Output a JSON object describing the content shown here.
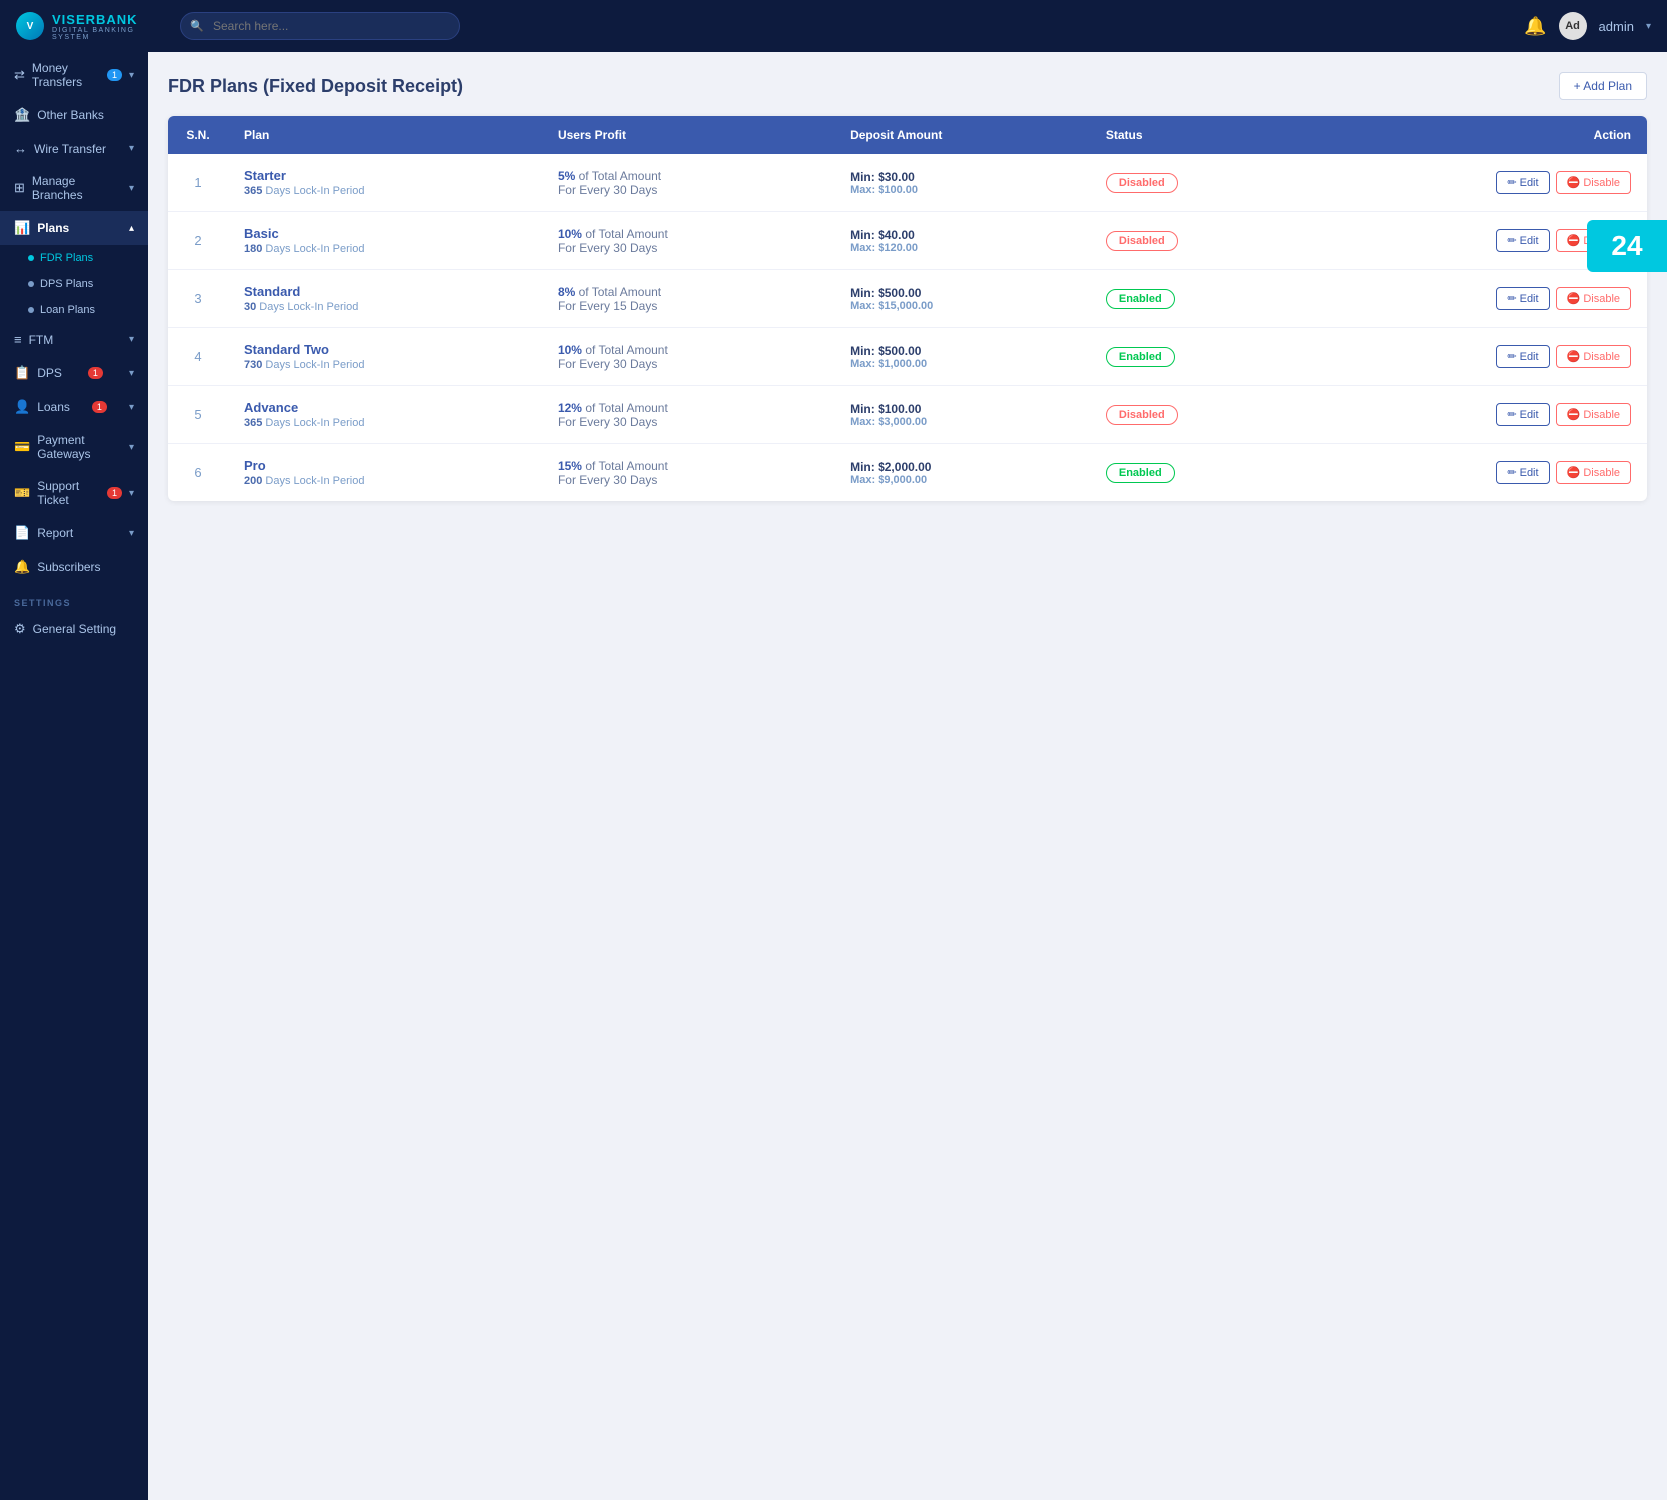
{
  "brand": {
    "logo_initials": "V",
    "name_part1": "VISER",
    "name_part2": "BANK",
    "sub": "DIGITAL BANKING SYSTEM"
  },
  "navbar": {
    "search_placeholder": "Search here...",
    "admin_label": "admin",
    "notification_badge": "24"
  },
  "sidebar": {
    "items": [
      {
        "id": "money-transfers",
        "label": "Money Transfers",
        "icon": "⇄",
        "badge": "1",
        "badge_color": "blue",
        "has_chevron": true
      },
      {
        "id": "other-banks",
        "label": "Other Banks",
        "icon": "🏦",
        "badge": null,
        "has_chevron": false
      },
      {
        "id": "wire-transfer",
        "label": "Wire Transfer",
        "icon": "↔",
        "badge": null,
        "has_chevron": true
      },
      {
        "id": "manage-branches",
        "label": "Manage Branches",
        "icon": "⊞",
        "badge": null,
        "has_chevron": true
      },
      {
        "id": "plans",
        "label": "Plans",
        "icon": "📊",
        "badge": null,
        "has_chevron": true,
        "active": true
      }
    ],
    "sub_items_plans": [
      {
        "id": "fdr-plans",
        "label": "FDR Plans",
        "active": true
      },
      {
        "id": "dps-plans",
        "label": "DPS Plans",
        "active": false
      },
      {
        "id": "loan-plans",
        "label": "Loan Plans",
        "active": false
      }
    ],
    "items2": [
      {
        "id": "ftm",
        "label": "FTM",
        "icon": "≡",
        "badge": null,
        "has_chevron": true
      },
      {
        "id": "dps",
        "label": "DPS",
        "icon": "📋",
        "badge": "1",
        "badge_color": "red",
        "has_chevron": true
      },
      {
        "id": "loans",
        "label": "Loans",
        "icon": "👤",
        "badge": "1",
        "badge_color": "red",
        "has_chevron": true
      },
      {
        "id": "payment-gateways",
        "label": "Payment Gateways",
        "icon": "💳",
        "badge": null,
        "has_chevron": true
      },
      {
        "id": "support-ticket",
        "label": "Support Ticket",
        "icon": "🎫",
        "badge": "1",
        "badge_color": "red",
        "has_chevron": true
      },
      {
        "id": "report",
        "label": "Report",
        "icon": "📄",
        "badge": null,
        "has_chevron": true
      },
      {
        "id": "subscribers",
        "label": "Subscribers",
        "icon": "🔔",
        "badge": null,
        "has_chevron": false
      }
    ],
    "section_settings": "SETTINGS",
    "settings_items": [
      {
        "id": "general-setting",
        "label": "General Setting",
        "icon": "⚙",
        "badge": null,
        "has_chevron": false
      }
    ]
  },
  "page": {
    "title": "FDR Plans (Fixed Deposit Receipt)",
    "add_button_label": "+ Add Plan"
  },
  "table": {
    "headers": [
      "S.N.",
      "Plan",
      "Users Profit",
      "Deposit Amount",
      "Status",
      "Action"
    ],
    "rows": [
      {
        "sn": "1",
        "plan_name": "Starter",
        "plan_sub_days": "365",
        "plan_sub_label": "Days Lock-In Period",
        "profit_pct": "5%",
        "profit_suffix": "of Total Amount",
        "profit_period": "For Every 30 Days",
        "deposit_min": "Min: $30.00",
        "deposit_max": "Max: $100.00",
        "status": "Disabled",
        "status_class": "disabled",
        "edit_label": "✏ Edit",
        "disable_label": "⛔ Disable"
      },
      {
        "sn": "2",
        "plan_name": "Basic",
        "plan_sub_days": "180",
        "plan_sub_label": "Days Lock-In Period",
        "profit_pct": "10%",
        "profit_suffix": "of Total Amount",
        "profit_period": "For Every 30 Days",
        "deposit_min": "Min: $40.00",
        "deposit_max": "Max: $120.00",
        "status": "Disabled",
        "status_class": "disabled",
        "edit_label": "✏ Edit",
        "disable_label": "⛔ Disable"
      },
      {
        "sn": "3",
        "plan_name": "Standard",
        "plan_sub_days": "30",
        "plan_sub_label": "Days Lock-In Period",
        "profit_pct": "8%",
        "profit_suffix": "of Total Amount",
        "profit_period": "For Every 15 Days",
        "deposit_min": "Min: $500.00",
        "deposit_max": "Max: $15,000.00",
        "status": "Enabled",
        "status_class": "enabled",
        "edit_label": "✏ Edit",
        "disable_label": "⛔ Disable"
      },
      {
        "sn": "4",
        "plan_name": "Standard Two",
        "plan_sub_days": "730",
        "plan_sub_label": "Days Lock-In Period",
        "profit_pct": "10%",
        "profit_suffix": "of Total Amount",
        "profit_period": "For Every 30 Days",
        "deposit_min": "Min: $500.00",
        "deposit_max": "Max: $1,000.00",
        "status": "Enabled",
        "status_class": "enabled",
        "edit_label": "✏ Edit",
        "disable_label": "⛔ Disable"
      },
      {
        "sn": "5",
        "plan_name": "Advance",
        "plan_sub_days": "365",
        "plan_sub_label": "Days Lock-In Period",
        "profit_pct": "12%",
        "profit_suffix": "of Total Amount",
        "profit_period": "For Every 30 Days",
        "deposit_min": "Min: $100.00",
        "deposit_max": "Max: $3,000.00",
        "status": "Disabled",
        "status_class": "disabled",
        "edit_label": "✏ Edit",
        "disable_label": "⛔ Disable"
      },
      {
        "sn": "6",
        "plan_name": "Pro",
        "plan_sub_days": "200",
        "plan_sub_label": "Days Lock-In Period",
        "profit_pct": "15%",
        "profit_suffix": "of Total Amount",
        "profit_period": "For Every 30 Days",
        "deposit_min": "Min: $2,000.00",
        "deposit_max": "Max: $9,000.00",
        "status": "Enabled",
        "status_class": "enabled",
        "edit_label": "✏ Edit",
        "disable_label": "⛔ Disable"
      }
    ]
  }
}
